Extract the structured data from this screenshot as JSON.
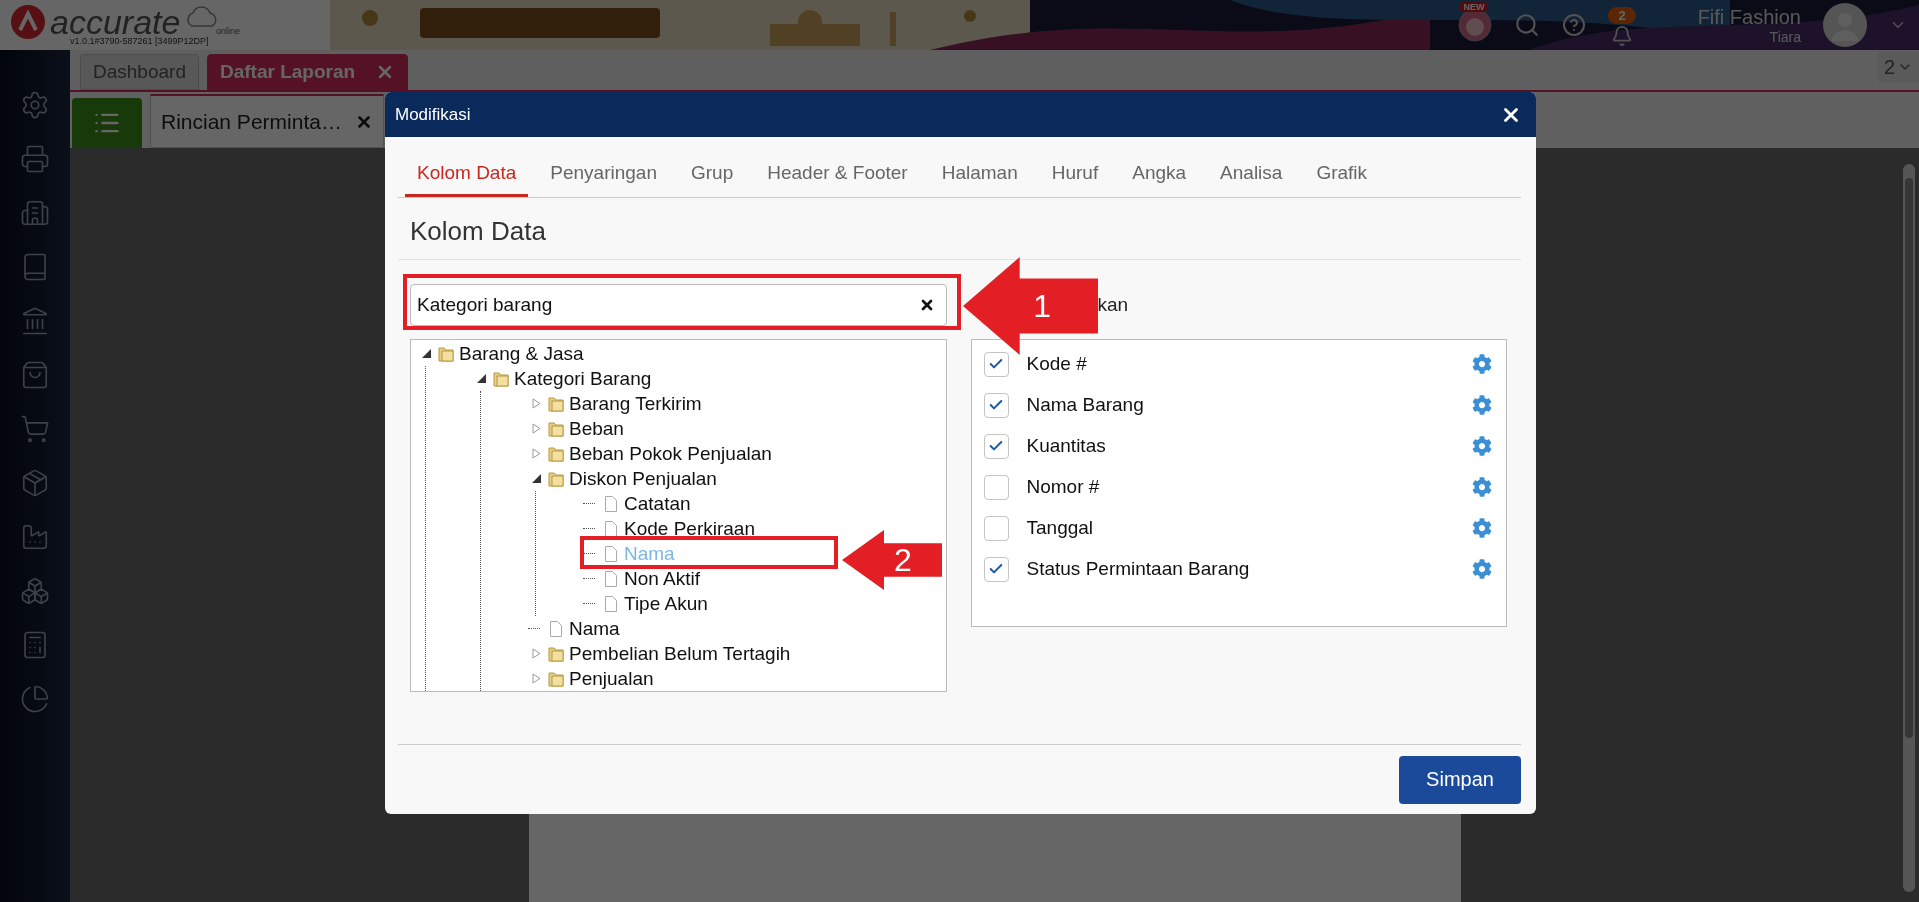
{
  "app": {
    "logo": "accurate",
    "logo_sub": "online",
    "version": "v1.0.1#3790-587261 [3499P12DP]"
  },
  "header": {
    "new_badge": "NEW",
    "notification_count": "2",
    "company": "Fifi Fashion",
    "user": "Tiara"
  },
  "tabs": [
    {
      "label": "Dashboard",
      "selected": false
    },
    {
      "label": "Daftar Laporan",
      "selected": true
    }
  ],
  "tab_count": "2",
  "report_tabs": [
    {
      "label": "Rincian Perminta…",
      "selected": true
    }
  ],
  "dialog": {
    "title": "Modifikasi",
    "tabs": [
      {
        "label": "Kolom Data",
        "selected": true
      },
      {
        "label": "Penyaringan",
        "selected": false
      },
      {
        "label": "Grup",
        "selected": false
      },
      {
        "label": "Header & Footer",
        "selected": false
      },
      {
        "label": "Halaman",
        "selected": false
      },
      {
        "label": "Huruf",
        "selected": false
      },
      {
        "label": "Angka",
        "selected": false
      },
      {
        "label": "Analisa",
        "selected": false
      },
      {
        "label": "Grafik",
        "selected": false
      }
    ],
    "heading": "Kolom Data",
    "search": {
      "value": "Kategori barang"
    },
    "columns_label": "kan",
    "tree": [
      {
        "label": "Barang & Jasa",
        "kind": "folder",
        "expanded": true,
        "selected": false,
        "children": [
          {
            "label": "Kategori Barang",
            "kind": "folder",
            "expanded": true,
            "selected": false,
            "children": [
              {
                "label": "Barang Terkirim",
                "kind": "folder",
                "expanded": false,
                "selected": false
              },
              {
                "label": "Beban",
                "kind": "folder",
                "expanded": false,
                "selected": false
              },
              {
                "label": "Beban Pokok Penjualan",
                "kind": "folder",
                "expanded": false,
                "selected": false
              },
              {
                "label": "Diskon Penjualan",
                "kind": "folder",
                "expanded": true,
                "selected": false,
                "children": [
                  {
                    "label": "Catatan",
                    "kind": "file",
                    "selected": false
                  },
                  {
                    "label": "Kode Perkiraan",
                    "kind": "file",
                    "selected": false
                  },
                  {
                    "label": "Nama",
                    "kind": "file",
                    "selected": true
                  },
                  {
                    "label": "Non Aktif",
                    "kind": "file",
                    "selected": false
                  },
                  {
                    "label": "Tipe Akun",
                    "kind": "file",
                    "selected": false
                  }
                ]
              },
              {
                "label": "Nama",
                "kind": "file",
                "selected": false
              },
              {
                "label": "Pembelian Belum Tertagih",
                "kind": "folder",
                "expanded": false,
                "selected": false
              },
              {
                "label": "Penjualan",
                "kind": "folder",
                "expanded": false,
                "selected": false
              }
            ]
          }
        ]
      }
    ],
    "columns": [
      {
        "label": "Kode #",
        "checked": true
      },
      {
        "label": "Nama Barang",
        "checked": true
      },
      {
        "label": "Kuantitas",
        "checked": true
      },
      {
        "label": "Nomor #",
        "checked": false
      },
      {
        "label": "Tanggal",
        "checked": false
      },
      {
        "label": "Status Permintaan Barang",
        "checked": true
      }
    ],
    "save": "Simpan"
  },
  "annotations": [
    {
      "label": "1"
    },
    {
      "label": "2"
    }
  ]
}
